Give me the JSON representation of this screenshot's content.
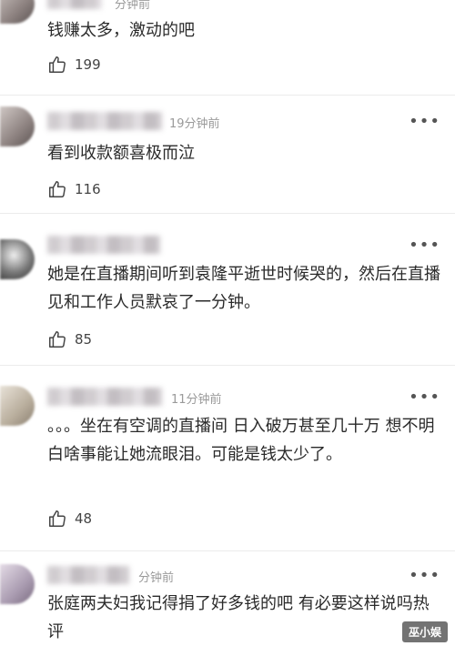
{
  "comments": [
    {
      "time": "分钟前",
      "text": "钱赚太多，激动的吧",
      "likes": "199"
    },
    {
      "time": "19分钟前",
      "text": "看到收款额喜极而泣",
      "likes": "116"
    },
    {
      "time": "",
      "text": "她是在直播期间听到袁隆平逝世时候哭的，然后在直播见和工作人员默哀了一分钟。",
      "likes": "85"
    },
    {
      "time": "11分钟前",
      "text": "。。。坐在有空调的直播间 日入破万甚至几十万 想不明白啥事能让她流眼泪。可能是钱太少了。",
      "likes": "48"
    },
    {
      "time": "分钟前",
      "text": "张庭两夫妇我记得捐了好多钱的吧 有必要这样说吗热评",
      "likes": ""
    }
  ],
  "watermark": "巫小娱",
  "icons": {
    "like": "thumbs-up-icon",
    "more": "more-dots-icon",
    "avatar": "blurred-avatar"
  }
}
